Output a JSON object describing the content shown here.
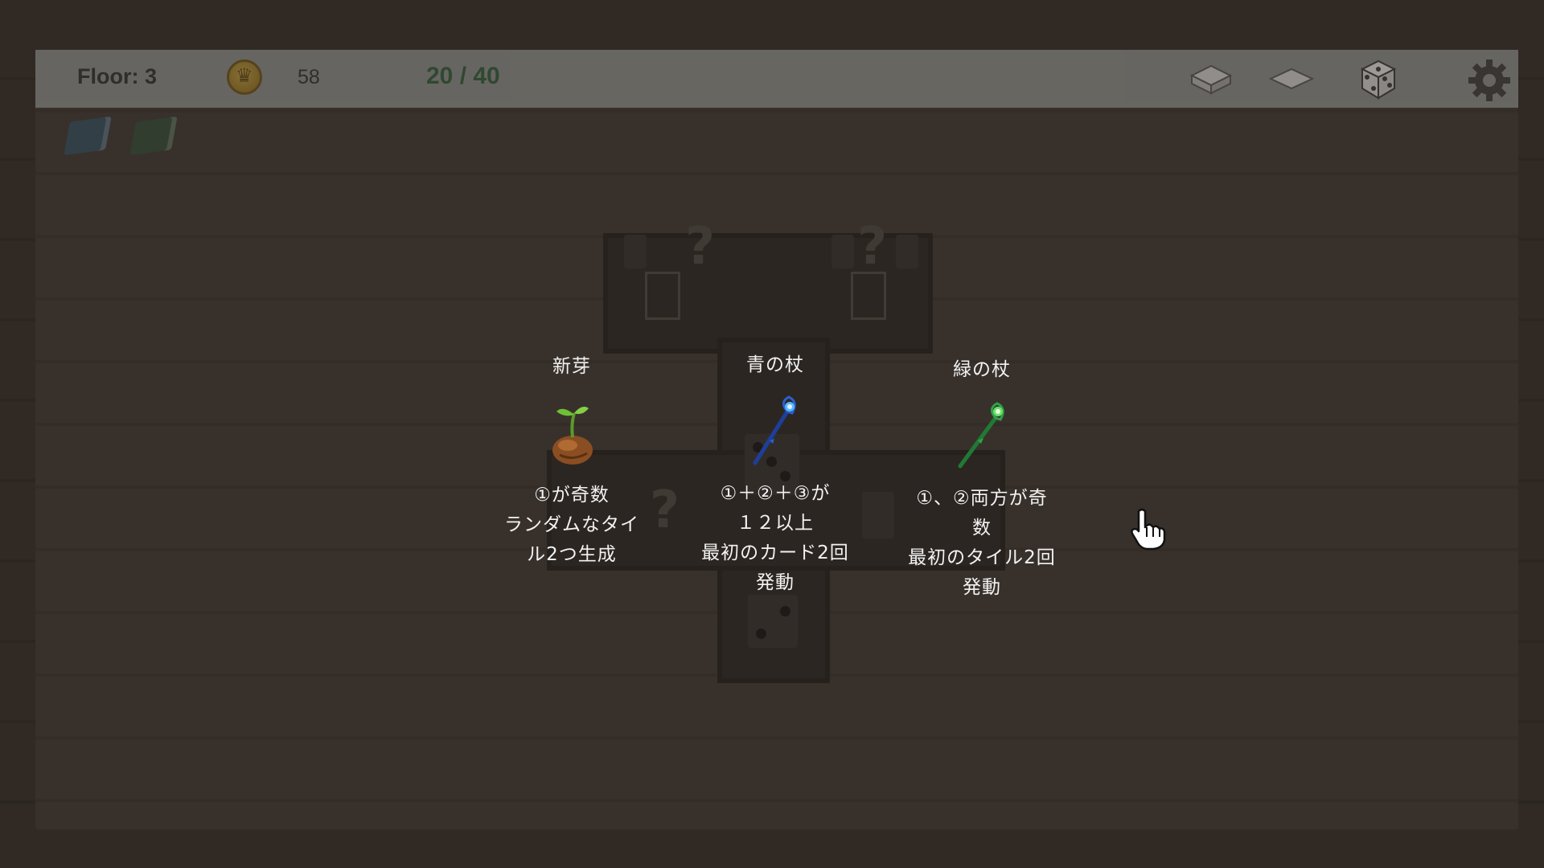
{
  "hud": {
    "floor": "Floor: 3",
    "gold": "58",
    "progress": "20 / 40"
  },
  "colors": {
    "hud_bg": "#8f918e",
    "progress_text": "#2b5b36",
    "reward_text": "#f2f2f2",
    "blue_staff": "#2a5fd0",
    "green_staff": "#2ea34a"
  },
  "icons": [
    "coin-icon",
    "tile-stack-icon",
    "tile-flat-icon",
    "dice-icon",
    "gear-icon",
    "blue-book-icon",
    "green-book-icon",
    "sprout-icon",
    "blue-staff-icon",
    "green-staff-icon",
    "hand-pointer-icon"
  ],
  "rewards": [
    {
      "name": "新芽",
      "icon": "sprout-icon",
      "desc": [
        "①が奇数",
        "ランダムなタイ",
        "ル2つ生成"
      ]
    },
    {
      "name": "青の杖",
      "icon": "blue-staff-icon",
      "desc": [
        "①＋②＋③が",
        "１２以上",
        "最初のカード2回",
        "発動"
      ]
    },
    {
      "name": "緑の杖",
      "icon": "green-staff-icon",
      "desc": [
        "①、②両方が奇",
        "数",
        "最初のタイル2回",
        "発動"
      ]
    }
  ]
}
